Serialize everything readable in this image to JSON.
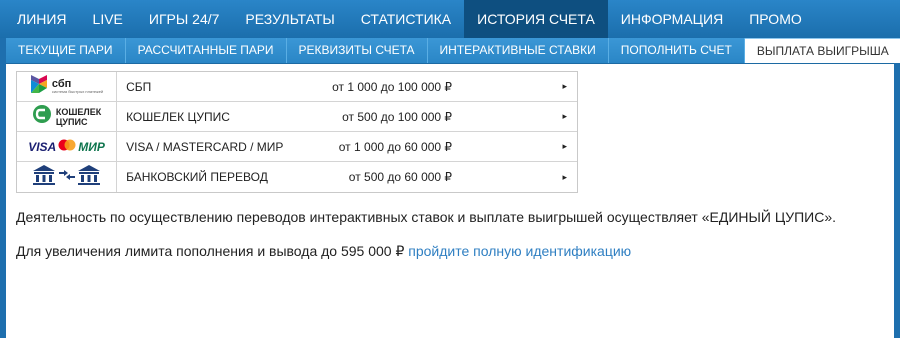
{
  "top_nav": [
    {
      "label": "ЛИНИЯ",
      "active": false
    },
    {
      "label": "LIVE",
      "active": false
    },
    {
      "label": "ИГРЫ 24/7",
      "active": false
    },
    {
      "label": "РЕЗУЛЬТАТЫ",
      "active": false
    },
    {
      "label": "СТАТИСТИКА",
      "active": false
    },
    {
      "label": "ИСТОРИЯ СЧЕТА",
      "active": true
    },
    {
      "label": "ИНФОРМАЦИЯ",
      "active": false
    },
    {
      "label": "ПРОМО",
      "active": false
    }
  ],
  "sub_nav": [
    {
      "label": "ТЕКУЩИЕ ПАРИ",
      "active": false
    },
    {
      "label": "РАССЧИТАННЫЕ ПАРИ",
      "active": false
    },
    {
      "label": "РЕКВИЗИТЫ СЧЕТА",
      "active": false
    },
    {
      "label": "ИНТЕРАКТИВНЫЕ СТАВКИ",
      "active": false
    },
    {
      "label": "ПОПОЛНИТЬ СЧЕТ",
      "active": false
    },
    {
      "label": "ВЫПЛАТА ВЫИГРЫША",
      "active": true
    }
  ],
  "payment_methods": [
    {
      "name": "СБП",
      "limits": "от 1 000 до 100 000 ₽",
      "logo": {
        "word": "сбп",
        "caption": "система быстрых платежей",
        "icon": "sbp-logo-icon"
      }
    },
    {
      "name": "КОШЕЛЕК ЦУПИС",
      "limits": "от 500 до 100 000 ₽",
      "logo": {
        "line1": "КОШЕЛЕК",
        "line2": "ЦУПИС",
        "icon": "cupis-wallet-icon"
      }
    },
    {
      "name": "VISA / MASTERCARD / МИР",
      "limits": "от 1 000 до 60 000 ₽",
      "logo": {
        "visa": "VISA",
        "mir": "МИР",
        "icon": "card-brands-icon"
      }
    },
    {
      "name": "БАНКОВСКИЙ ПЕРЕВОД",
      "limits": "от 500 до 60 000 ₽",
      "logo": {
        "icon": "bank-transfer-icon"
      }
    }
  ],
  "row_arrow": "▸",
  "info": {
    "operator_text": "Деятельность по осуществлению переводов интерактивных ставок и выплате выигрышей осуществляет «ЕДИНЫЙ ЦУПИС».",
    "limit_text": "Для увеличения лимита пополнения и вывода до 595 000 ₽ ",
    "limit_link": "пройдите полную идентификацию"
  },
  "colors": {
    "nav_bg": "#1b6eac",
    "nav_active": "#0e4f80",
    "subnav_bg": "#2a86c6",
    "link": "#2f7fc2",
    "mastercard_red": "#eb001b",
    "mastercard_orange": "#f79e1b"
  }
}
